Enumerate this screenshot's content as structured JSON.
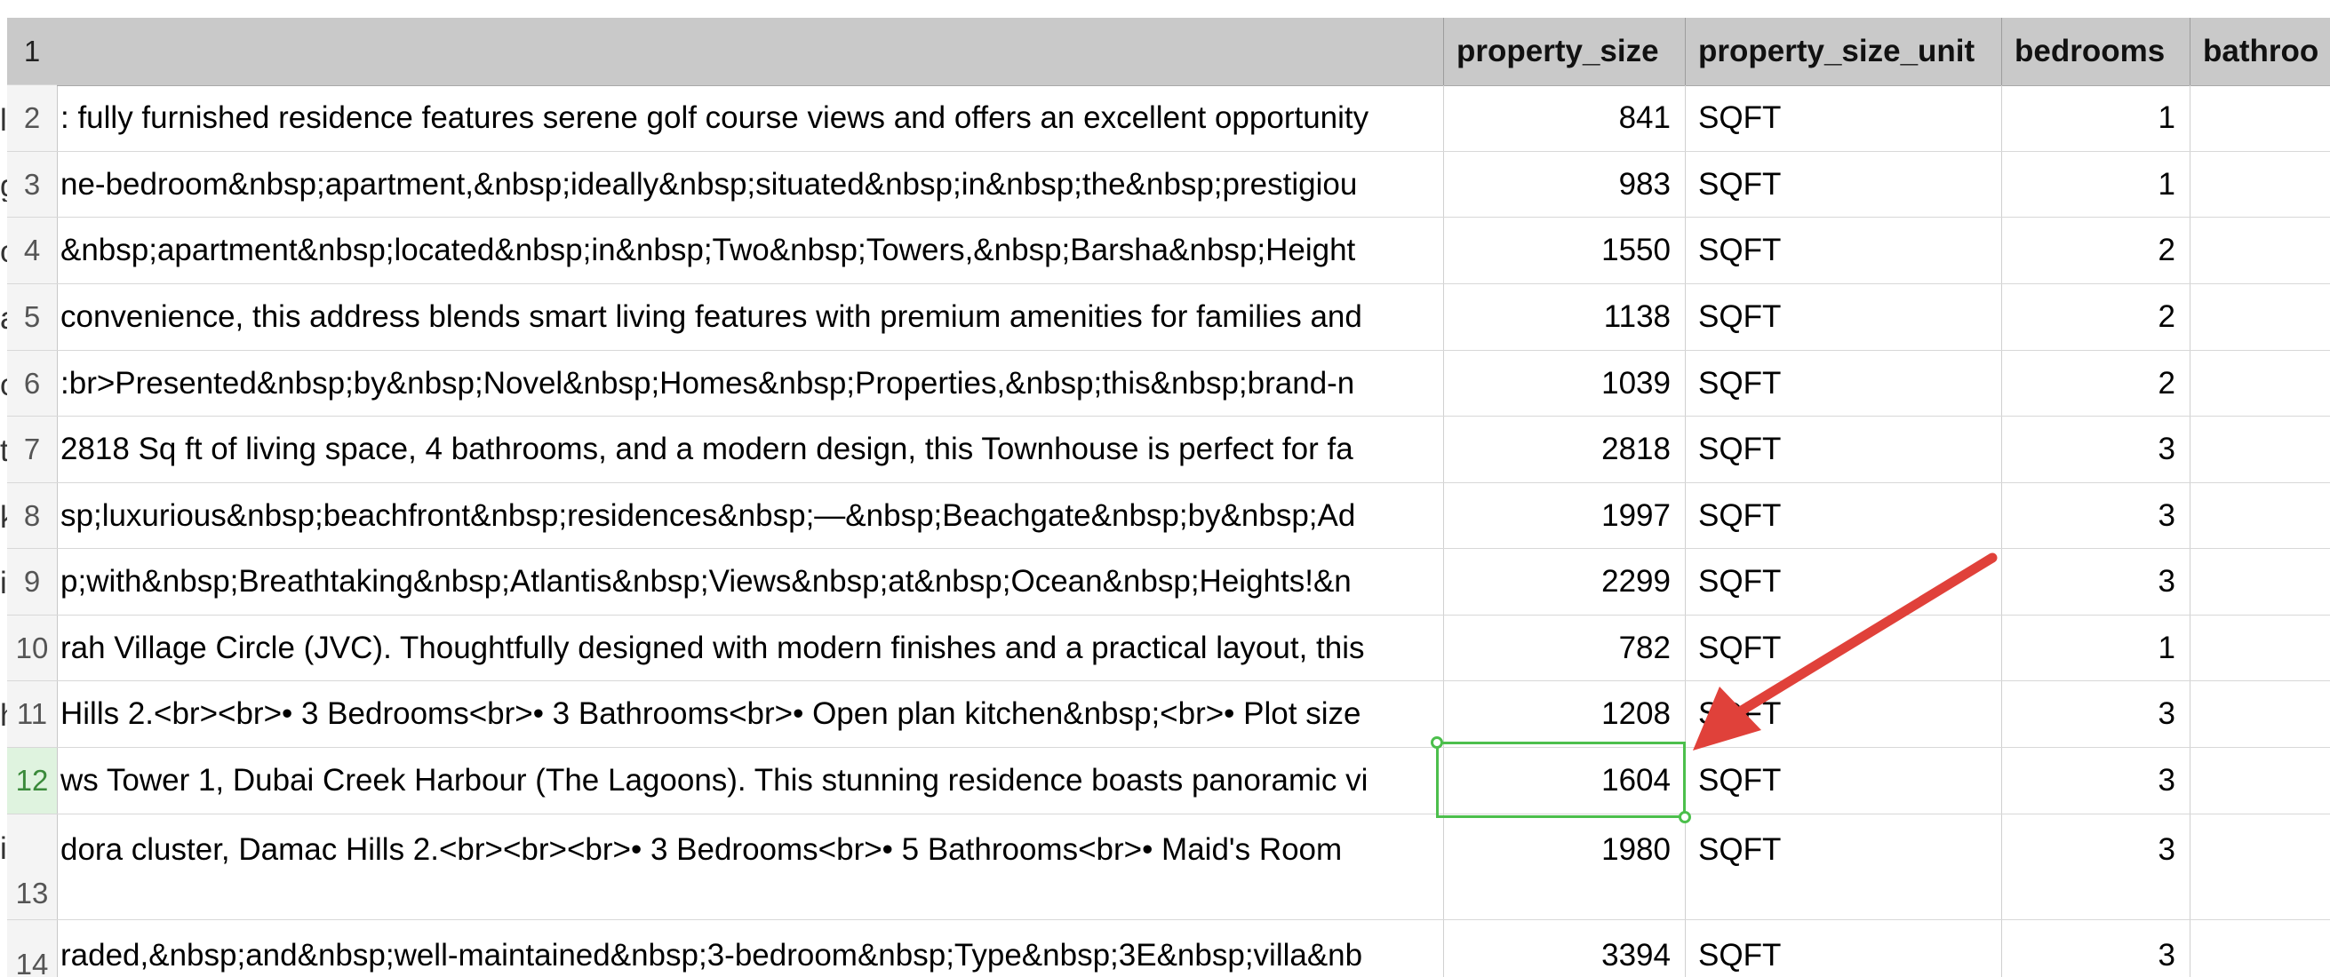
{
  "columns": {
    "property_size": "property_size",
    "property_size_unit": "property_size_unit",
    "bedrooms": "bedrooms",
    "bathrooms": "bathroo"
  },
  "header_row_number": "1",
  "rows": [
    {
      "num": "2",
      "desc": ": fully furnished residence features serene golf course views and offers an excellent opportunity",
      "size": "841",
      "unit": "SQFT",
      "beds": "1",
      "clip": "l"
    },
    {
      "num": "3",
      "desc": "ne-bedroom&nbsp;apartment,&nbsp;ideally&nbsp;situated&nbsp;in&nbsp;the&nbsp;prestigiou",
      "size": "983",
      "unit": "SQFT",
      "beds": "1",
      "clip": "g"
    },
    {
      "num": "4",
      "desc": "&nbsp;apartment&nbsp;located&nbsp;in&nbsp;Two&nbsp;Towers,&nbsp;Barsha&nbsp;Height",
      "size": "1550",
      "unit": "SQFT",
      "beds": "2",
      "clip": "o"
    },
    {
      "num": "5",
      "desc": " convenience, this address blends smart living features with premium amenities for families and",
      "size": "1138",
      "unit": "SQFT",
      "beds": "2",
      "clip": "a"
    },
    {
      "num": "6",
      "desc": ":br>Presented&nbsp;by&nbsp;Novel&nbsp;Homes&nbsp;Properties,&nbsp;this&nbsp;brand-n",
      "size": "1039",
      "unit": "SQFT",
      "beds": "2",
      "clip": "o"
    },
    {
      "num": "7",
      "desc": " 2818 Sq ft of living space, 4 bathrooms, and a modern design, this Townhouse is perfect for fa",
      "size": "2818",
      "unit": "SQFT",
      "beds": "3",
      "clip": "t"
    },
    {
      "num": "8",
      "desc": "sp;luxurious&nbsp;beachfront&nbsp;residences&nbsp;—&nbsp;Beachgate&nbsp;by&nbsp;Ad",
      "size": "1997",
      "unit": "SQFT",
      "beds": "3",
      "clip": "k"
    },
    {
      "num": "9",
      "desc": "p;with&nbsp;Breathtaking&nbsp;Atlantis&nbsp;Views&nbsp;at&nbsp;Ocean&nbsp;Heights!&n",
      "size": "2299",
      "unit": "SQFT",
      "beds": "3",
      "clip": "i"
    },
    {
      "num": "10",
      "desc": "rah Village Circle (JVC). Thoughtfully designed with modern finishes and a practical layout, this",
      "size": "782",
      "unit": "SQFT",
      "beds": "1",
      "clip": ""
    },
    {
      "num": "11",
      "desc": "Hills 2.<br><br>• 3 Bedrooms<br>• 3 Bathrooms<br>• Open plan kitchen&nbsp;<br>• Plot size",
      "size": "1208",
      "unit": "SQFT",
      "beds": "3",
      "clip": "h"
    },
    {
      "num": "12",
      "desc": "ws Tower 1, Dubai Creek Harbour (The Lagoons). This stunning residence boasts panoramic vi",
      "size": "1604",
      "unit": "SQFT",
      "beds": "3",
      "clip": ""
    },
    {
      "num": "13",
      "desc": "dora cluster, Damac Hills 2.<br><br><br>• 3 Bedrooms<br>• 5 Bathrooms<br>• Maid's Room",
      "size": "1980",
      "unit": "SQFT",
      "beds": "3",
      "clip": "i"
    },
    {
      "num": "14",
      "desc": "raded,&nbsp;and&nbsp;well-maintained&nbsp;3-bedroom&nbsp;Type&nbsp;3E&nbsp;villa&nb",
      "size": "3394",
      "unit": "SQFT",
      "beds": "3",
      "clip": ""
    }
  ],
  "accent": {
    "selection": "#4cbf4c",
    "annotation_arrow": "#e0413a"
  }
}
